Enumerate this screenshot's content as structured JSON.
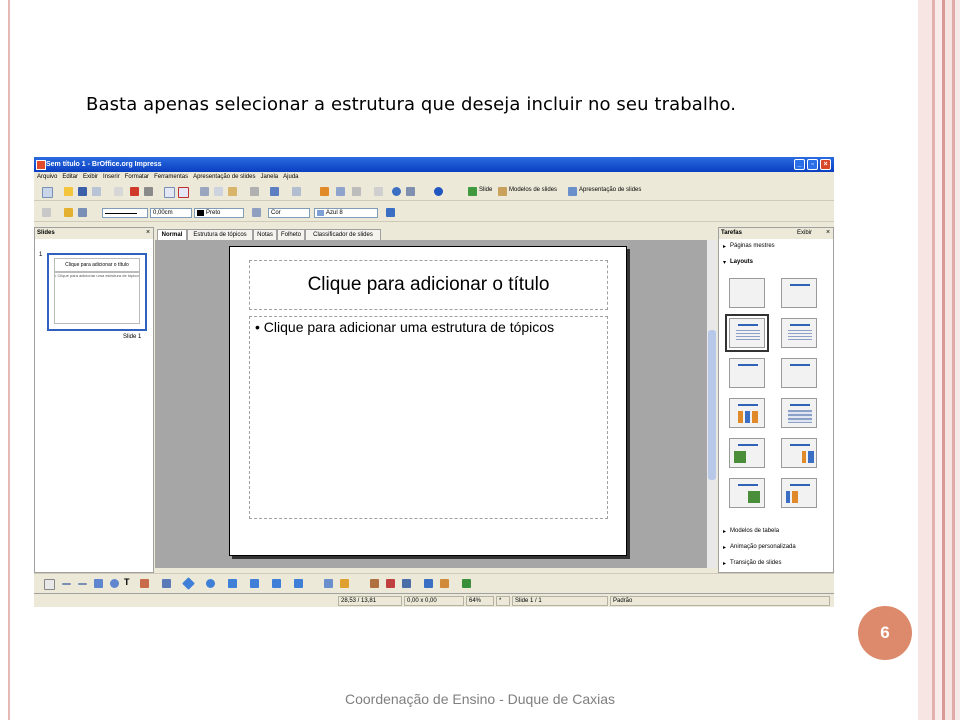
{
  "slide_caption": "Basta apenas selecionar a estrutura que deseja incluir no seu trabalho.",
  "slide_number": "6",
  "footer": "Coordenação de Ensino - Duque de Caxias",
  "window": {
    "title": "Sem título 1 - BrOffice.org Impress",
    "menu": [
      "Arquivo",
      "Editar",
      "Exibir",
      "Inserir",
      "Formatar",
      "Ferramentas",
      "Apresentação de slides",
      "Janela",
      "Ajuda"
    ],
    "toolbar1": {
      "slide": "Slide",
      "modelos": "Modelos de slides",
      "apresentacao": "Apresentação de slides"
    },
    "toolbar2": {
      "line_width": "0,00cm",
      "line_color": "Preto",
      "fill_type": "Cor",
      "fill_color": "Azul 8"
    },
    "slides_pane": {
      "title": "Slides",
      "thumb_title": "Clique para adicionar o título",
      "thumb_body": "• Clique para adicionar uma estrutura de tópicos",
      "thumb_label": "Slide 1",
      "thumb_index": "1"
    },
    "tabs": [
      "Normal",
      "Estrutura de tópicos",
      "Notas",
      "Folheto",
      "Classificador de slides"
    ],
    "slide": {
      "title_placeholder": "Clique para adicionar o título",
      "body_placeholder": "• Clique para adicionar uma estrutura de tópicos"
    },
    "tasks": {
      "title": "Tarefas",
      "view": "Exibir",
      "paginas": "Páginas mestres",
      "layouts": "Layouts",
      "modelos_tabela": "Modelos de tabela",
      "animacao": "Animação personalizada",
      "transicao": "Transição de slides"
    },
    "status": {
      "position": "28,53 / 13,81",
      "size": "0,00 x 0,00",
      "zoom": "64%",
      "modified": "*",
      "slide": "Slide 1 / 1",
      "master": "Padrão"
    }
  }
}
